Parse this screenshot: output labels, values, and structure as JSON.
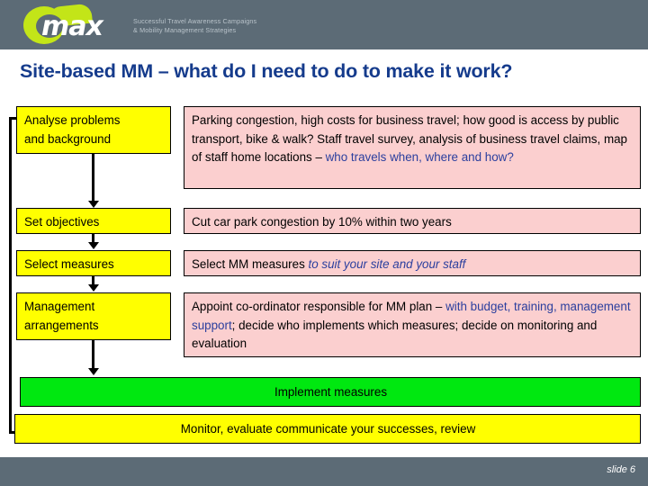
{
  "header": {
    "logo_word": "max",
    "logo_icon": "max-swoosh-logo",
    "tagline_line1": "Successful Travel Awareness Campaigns",
    "tagline_line2": "& Mobility Management Strategies",
    "band_color": "#5c6b76",
    "logo_green": "#c3e518"
  },
  "title": "Site-based MM – what do I need to do to make it work?",
  "colors": {
    "title_blue": "#153b8c",
    "yellow": "#ffff00",
    "pink": "#fbcfcf",
    "green": "#00e810",
    "highlight_blue": "#2b3f9e"
  },
  "rows": [
    {
      "step": "Analyse problems\nand background",
      "step_line1": "Analyse problems",
      "step_line2": "and background",
      "detail_plain_1": "Parking congestion, high costs for business travel; how good is access by public transport, bike & walk? Staff travel survey, analysis of business travel claims, map of staff home locations – ",
      "detail_blue_1": "who travels when, where and how?",
      "detail_plain_2": ""
    },
    {
      "step": "Set objectives",
      "step_line1": "Set objectives",
      "step_line2": "",
      "detail_plain_1": "Cut car park congestion by 10% within two years",
      "detail_blue_1": "",
      "detail_plain_2": ""
    },
    {
      "step": "Select measures",
      "step_line1": "Select measures",
      "step_line2": "",
      "detail_plain_1": "Select MM measures ",
      "detail_blue_1": "to suit your site and your staff",
      "detail_plain_2": ""
    },
    {
      "step": "Management\narrangements",
      "step_line1": "Management",
      "step_line2": "arrangements",
      "detail_plain_1": "Appoint co-ordinator responsible for MM plan – ",
      "detail_blue_1": "with budget, training, management support",
      "detail_plain_2": "; decide who implements which measures; decide on monitoring and evaluation"
    }
  ],
  "implement_bar": "Implement measures",
  "monitor_bar": "Monitor, evaluate communicate your successes, review",
  "footer": {
    "slide_label": "slide 6"
  }
}
